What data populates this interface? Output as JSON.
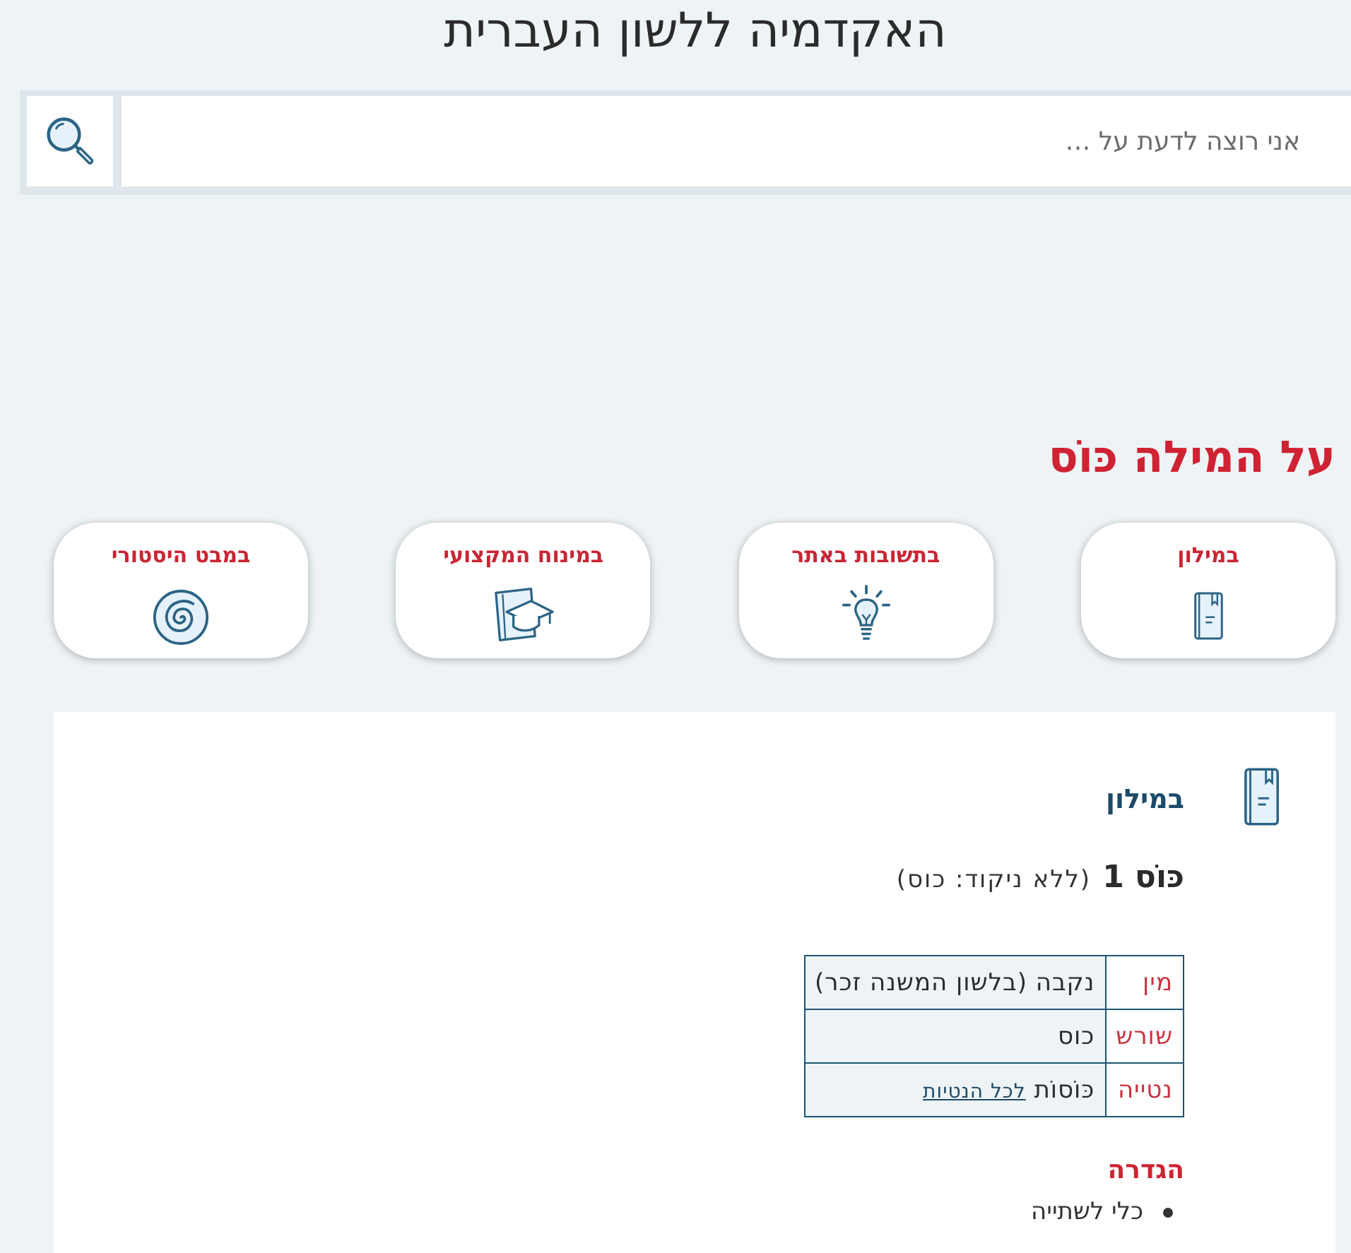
{
  "header": {
    "title": "האקדמיה ללשון העברית"
  },
  "search": {
    "placeholder": "אני רוצה לדעת על …"
  },
  "word_heading": "על המילה כּוֹס",
  "sections": [
    {
      "label": "במילון"
    },
    {
      "label": "בתשובות באתר"
    },
    {
      "label": "במינוח המקצועי"
    },
    {
      "label": "במבט היסטורי"
    }
  ],
  "entry": {
    "section_title": "במילון",
    "headword": "כּוֹס 1",
    "unpointed": "(ללא ניקוד: כוס)",
    "properties": [
      {
        "label": "מין",
        "value": "נקבה (בלשון המשנה זכר)"
      },
      {
        "label": "שורש",
        "value": "כוס"
      },
      {
        "label": "נטייה",
        "value": "כּוֹסוֹת",
        "link": "לכל הנטיות"
      }
    ],
    "definition_title": "הגדרה",
    "definitions": [
      "כלי לשתייה"
    ]
  }
}
